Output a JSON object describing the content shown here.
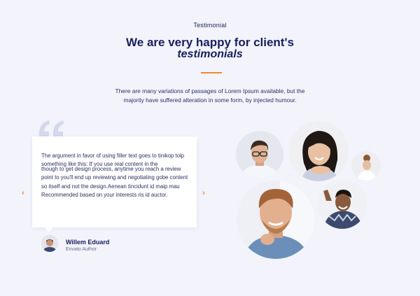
{
  "section": {
    "eyebrow": "Testimonial",
    "title_line1": "We are very happy for client's",
    "title_line2": "testimonials",
    "intro": "There are many variations of passages of Lorem Ipsum available, but the majority have suffered alteration in some form, by injected humour."
  },
  "testimonial": {
    "text_line1": "The argument in favor of using filler text goes to tinikop tolp something like this: If you use real content in the",
    "text_overlap": "though to get design process, anytime you reach a review point to you'll end up reviewing and negotiating gobe content so itself and not the design.Aenean tincidunt id maip mau Recommended based on your interests ris id auctor.",
    "author_name": "Willem Eduard",
    "author_role": "Envato Author"
  },
  "controls": {
    "prev_icon": "‹",
    "next_icon": "›"
  },
  "colors": {
    "background": "#f2f3fb",
    "heading": "#171f5c",
    "accent": "#f08a2b",
    "quote": "#d4d8ec"
  }
}
